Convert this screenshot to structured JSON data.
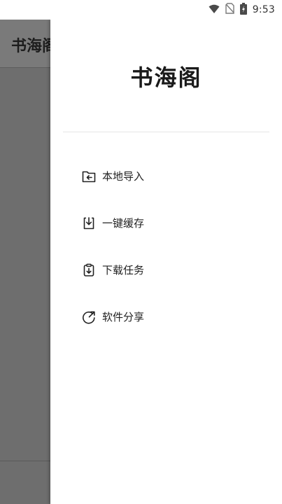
{
  "status_bar": {
    "time": "9:53",
    "icons": [
      "wifi-icon",
      "no-sim-icon",
      "battery-icon"
    ]
  },
  "background_app": {
    "title": "书海阁"
  },
  "drawer": {
    "logo_text": "书海阁",
    "menu": [
      {
        "label": "本地导入",
        "icon": "folder-import-icon"
      },
      {
        "label": "一键缓存",
        "icon": "download-cache-icon"
      },
      {
        "label": "下载任务",
        "icon": "download-task-icon"
      },
      {
        "label": "软件分享",
        "icon": "share-icon"
      }
    ]
  }
}
